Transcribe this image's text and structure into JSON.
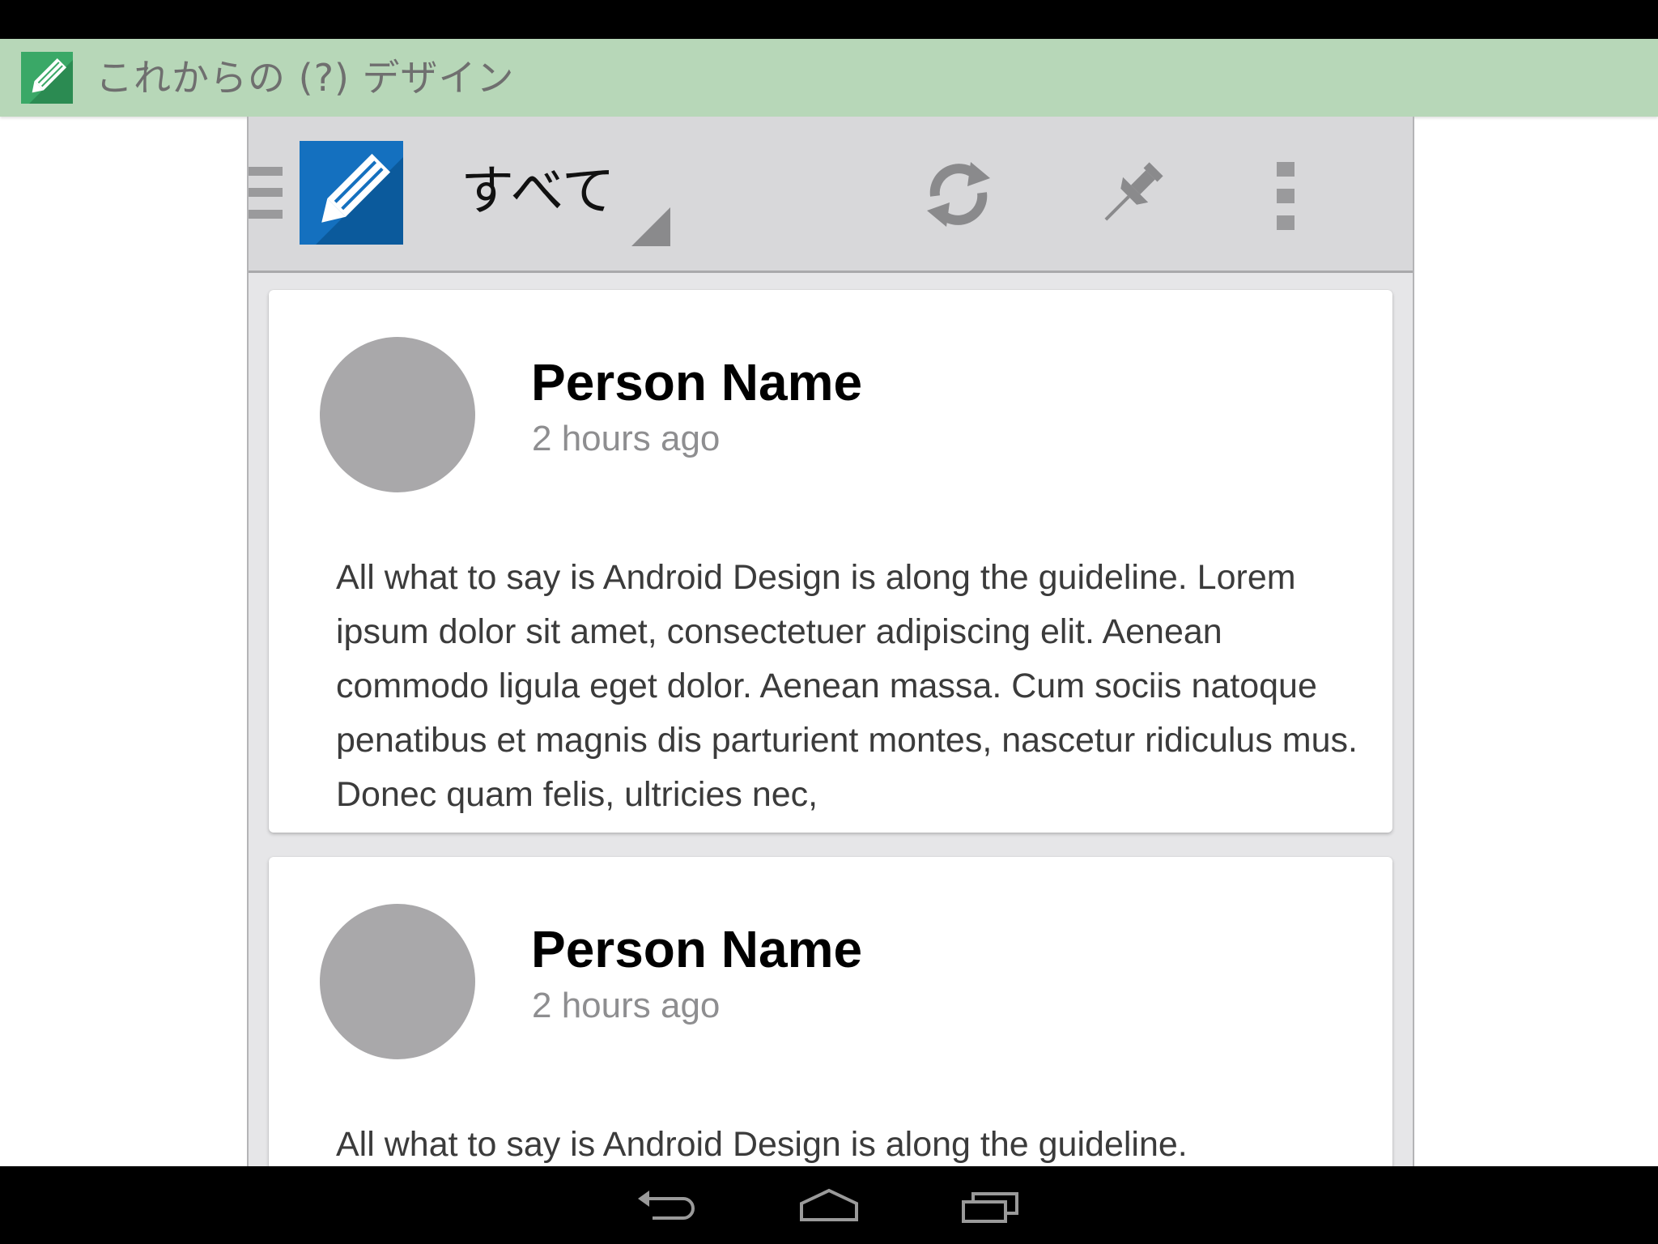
{
  "app": {
    "title": "これからの (?) デザイン",
    "logo_icon": "pencil-icon",
    "header_color": "#b7d7b8",
    "logo_color": "#3aa867"
  },
  "action_bar": {
    "drawer_icon": "drawer-menu-icon",
    "brand_icon": "pencil-icon",
    "brand_color": "#1470bf",
    "nav_title": "すべて",
    "actions": [
      {
        "name": "sync",
        "icon": "sync-icon"
      },
      {
        "name": "pin",
        "icon": "pin-icon"
      },
      {
        "name": "overflow",
        "icon": "overflow-menu-icon"
      }
    ]
  },
  "feed": {
    "posts": [
      {
        "author": "Person Name",
        "time": "2 hours ago",
        "body": "All what to say is Android Design is along the guideline. Lorem ipsum dolor sit amet, consectetuer adipiscing elit. Aenean commodo ligula eget dolor. Aenean massa. Cum sociis natoque penatibus et magnis dis parturient montes, nascetur ridiculus mus. Donec quam felis, ultricies nec,"
      },
      {
        "author": "Person Name",
        "time": "2 hours ago",
        "body": "All what to say is Android Design is along the guideline."
      }
    ]
  },
  "system_nav": {
    "buttons": [
      "back-icon",
      "home-icon",
      "recents-icon"
    ]
  }
}
